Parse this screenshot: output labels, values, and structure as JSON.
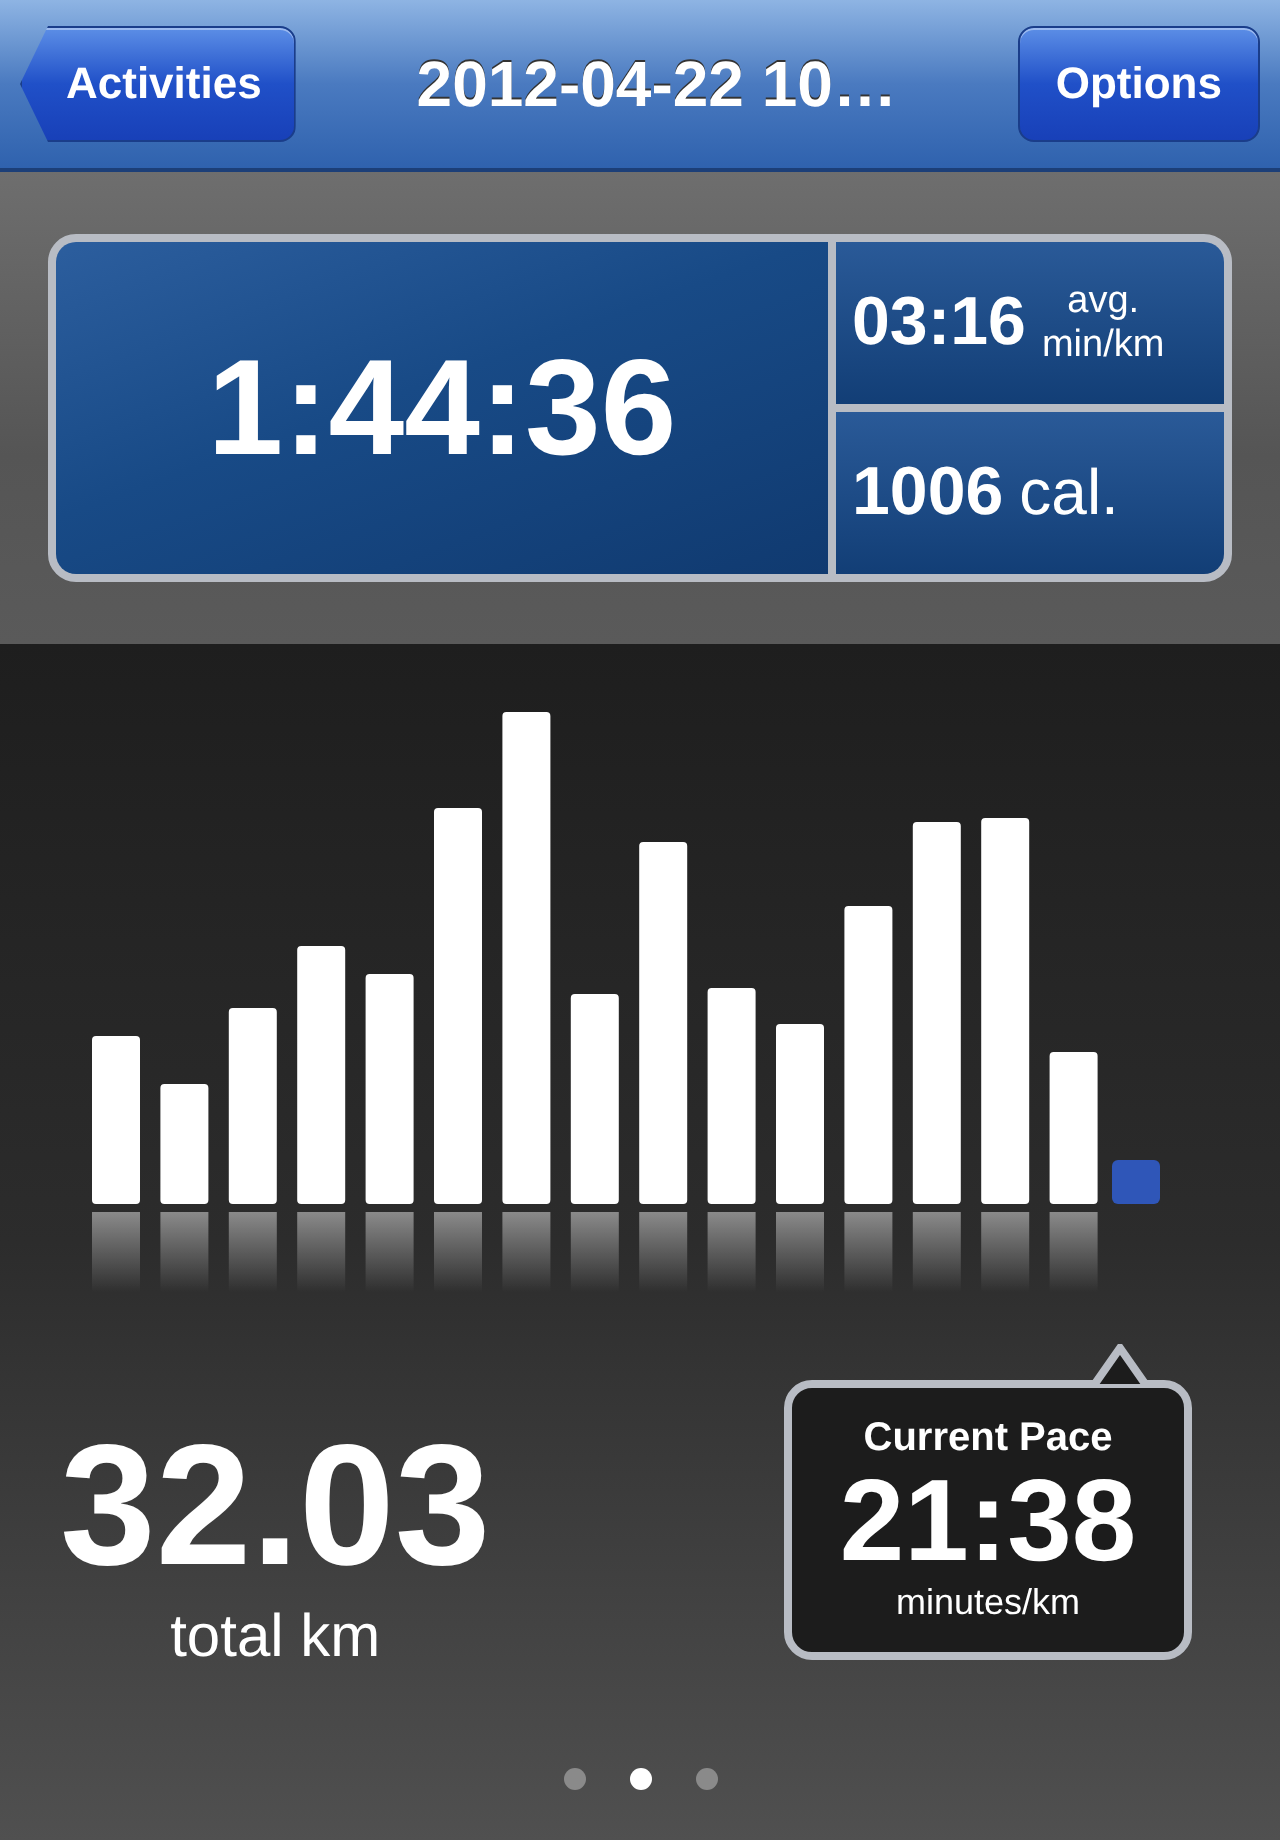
{
  "nav_bar": {
    "back_button": "Activities",
    "title": "2012-04-22 10…",
    "options_button": "Options"
  },
  "summary": {
    "duration": "1:44:36",
    "pace": "03:16",
    "pace_unit_top": "avg.",
    "pace_unit_bottom": "min/km",
    "calories": "1006",
    "calories_unit": "cal."
  },
  "distance": {
    "value": "32.03",
    "unit": "total km"
  },
  "current_pace": {
    "label": "Current Pace",
    "value": "21:38",
    "unit": "minutes/km"
  },
  "page_dots": [
    {
      "selected": false
    },
    {
      "selected": true
    },
    {
      "selected": false
    }
  ]
}
